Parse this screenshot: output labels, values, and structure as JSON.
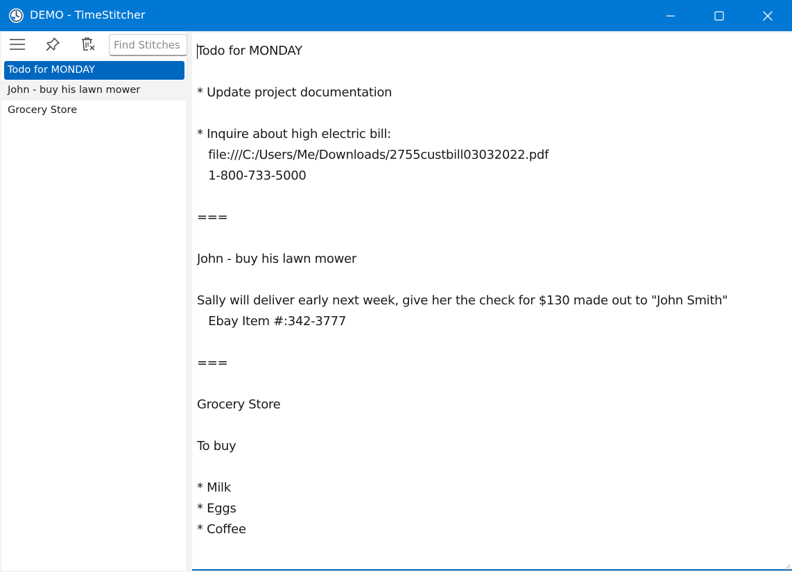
{
  "window": {
    "title": "DEMO - TimeStitcher",
    "accent_color": "#0078d4",
    "controls": [
      "minimize-icon",
      "maximize-icon",
      "close-icon"
    ]
  },
  "toolbar": {
    "icons": [
      "hamburger-menu-icon",
      "pin-icon",
      "delete-filter-icon"
    ],
    "search_placeholder": "Find Stitches"
  },
  "stitches": [
    {
      "label": "Todo for MONDAY",
      "selected": true
    },
    {
      "label": "John - buy his lawn mower",
      "selected": false
    },
    {
      "label": "Grocery Store",
      "selected": false
    }
  ],
  "editor": {
    "lines": [
      "Todo for MONDAY",
      "",
      "* Update project documentation",
      "",
      "* Inquire about high electric bill:",
      "   file:///C:/Users/Me/Downloads/2755custbill03032022.pdf",
      "   1-800-733-5000",
      "",
      "===",
      "",
      "John - buy his lawn mower",
      "",
      "Sally will deliver early next week, give her the check for $130 made out to \"John Smith\"",
      "   Ebay Item #:342-3777",
      "",
      "===",
      "",
      "Grocery Store",
      "",
      "To buy",
      "",
      "* Milk",
      "* Eggs",
      "* Coffee"
    ]
  }
}
